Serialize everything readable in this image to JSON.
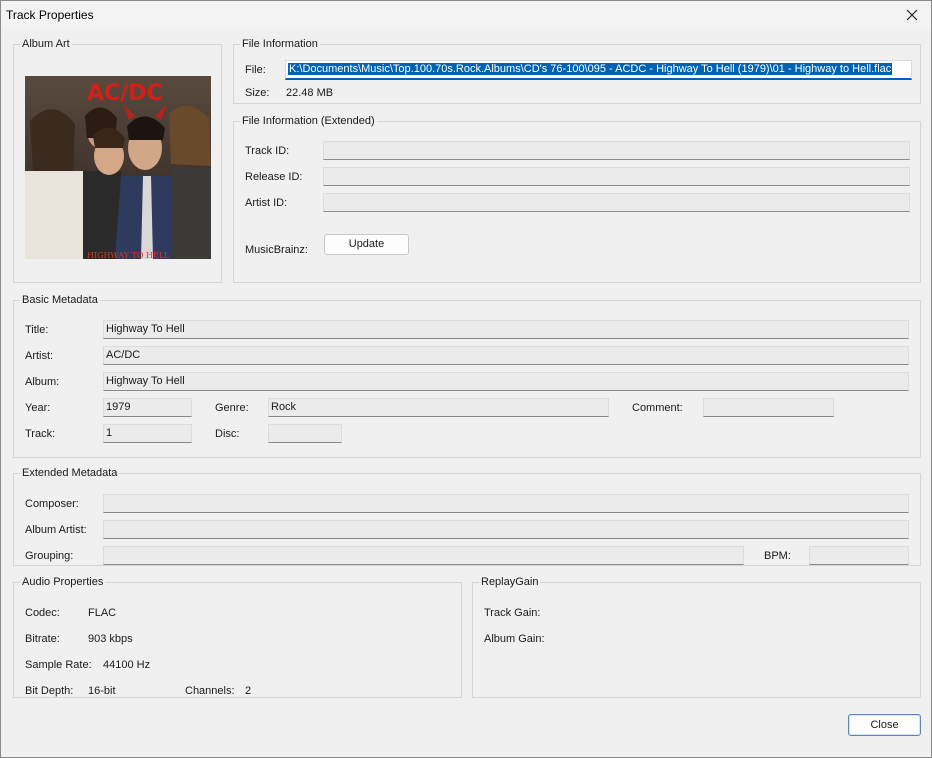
{
  "window": {
    "title": "Track Properties"
  },
  "album_art": {
    "group_label": "Album Art",
    "image": {
      "band_logo": "AC/DC",
      "cover_text": "HIGHWAY TO HELL"
    }
  },
  "file_info": {
    "group_label": "File Information",
    "file_label": "File:",
    "file_value": "K:\\Documents\\Music\\Top.100.70s.Rock.Albums\\CD's 76-100\\095 - ACDC - Highway To Hell (1979)\\01 - Highway to Hell.flac",
    "size_label": "Size:",
    "size_value": "22.48 MB"
  },
  "file_info_ext": {
    "group_label": "File Information (Extended)",
    "track_id_label": "Track ID:",
    "track_id_value": "",
    "release_id_label": "Release ID:",
    "release_id_value": "",
    "artist_id_label": "Artist ID:",
    "artist_id_value": "",
    "musicbrainz_label": "MusicBrainz:",
    "update_button": "Update"
  },
  "basic_metadata": {
    "group_label": "Basic Metadata",
    "title_label": "Title:",
    "title_value": "Highway To Hell",
    "artist_label": "Artist:",
    "artist_value": "AC/DC",
    "album_label": "Album:",
    "album_value": "Highway To Hell",
    "year_label": "Year:",
    "year_value": "1979",
    "genre_label": "Genre:",
    "genre_value": "Rock",
    "comment_label": "Comment:",
    "comment_value": "",
    "track_label": "Track:",
    "track_value": "1",
    "disc_label": "Disc:",
    "disc_value": ""
  },
  "extended_metadata": {
    "group_label": "Extended Metadata",
    "composer_label": "Composer:",
    "composer_value": "",
    "album_artist_label": "Album Artist:",
    "album_artist_value": "",
    "grouping_label": "Grouping:",
    "grouping_value": "",
    "bpm_label": "BPM:",
    "bpm_value": ""
  },
  "audio_properties": {
    "group_label": "Audio Properties",
    "codec_label": "Codec:",
    "codec_value": "FLAC",
    "bitrate_label": "Bitrate:",
    "bitrate_value": "903 kbps",
    "sample_rate_label": "Sample Rate:",
    "sample_rate_value": "44100 Hz",
    "bit_depth_label": "Bit Depth:",
    "bit_depth_value": "16-bit",
    "channels_label": "Channels:",
    "channels_value": "2"
  },
  "replay_gain": {
    "group_label": "ReplayGain",
    "track_gain_label": "Track Gain:",
    "album_gain_label": "Album Gain:"
  },
  "footer": {
    "close_button": "Close"
  },
  "colors": {
    "selection": "#0063b1",
    "focus_underline": "#0060c0",
    "window_bg": "#f0f0f0"
  },
  "icons": {
    "close": "close-icon"
  }
}
